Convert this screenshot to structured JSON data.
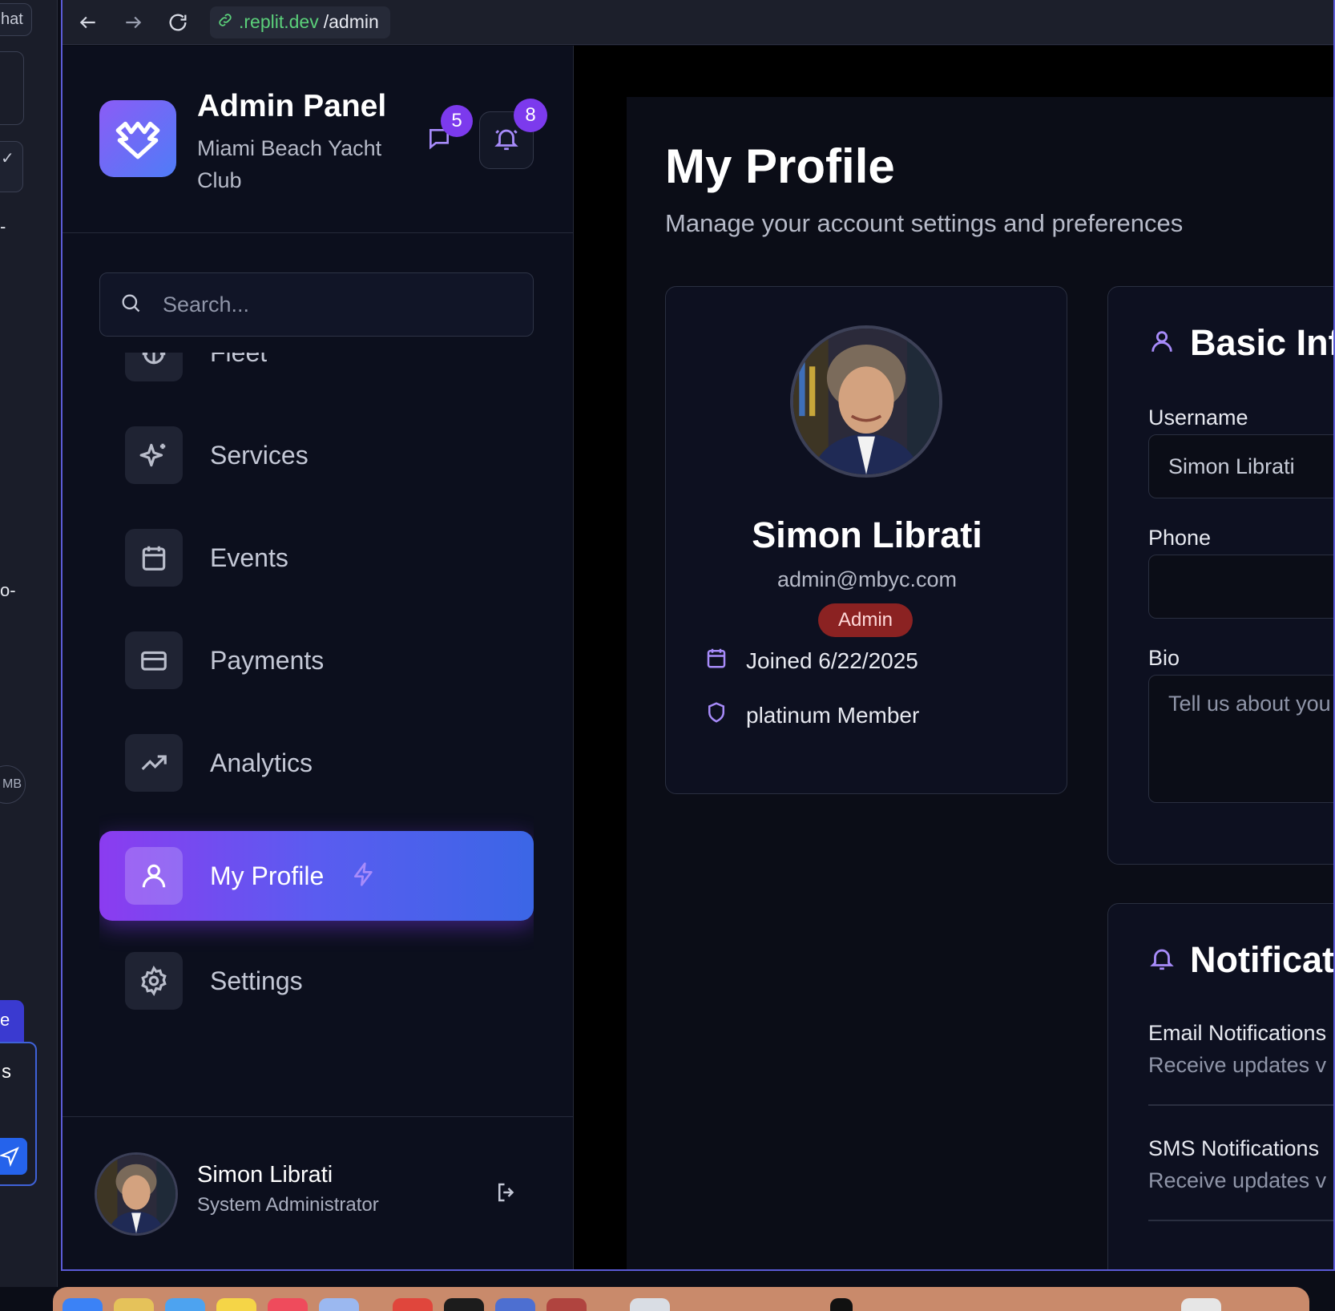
{
  "left_strip": {
    "chip_top": "hat",
    "chip_mid": "✓",
    "text_dash": "-",
    "text_o": "o-",
    "avatar_initials": "MB",
    "blue_tab": "e",
    "panel_letter": "s"
  },
  "browser": {
    "url_host": ".replit.dev",
    "url_path": "/admin"
  },
  "sidebar": {
    "title": "Admin Panel",
    "subtitle": "Miami Beach Yacht Club",
    "message_badge": "5",
    "notification_badge": "8",
    "search_placeholder": "Search...",
    "items": [
      {
        "label": "Fleet",
        "icon": "anchor-icon"
      },
      {
        "label": "Services",
        "icon": "sparkles-icon"
      },
      {
        "label": "Events",
        "icon": "calendar-icon"
      },
      {
        "label": "Payments",
        "icon": "credit-card-icon"
      },
      {
        "label": "Analytics",
        "icon": "trending-up-icon"
      },
      {
        "label": "My Profile",
        "icon": "user-icon",
        "active": true
      },
      {
        "label": "Settings",
        "icon": "gear-icon"
      }
    ],
    "footer": {
      "name": "Simon Librati",
      "role": "System Administrator"
    }
  },
  "main": {
    "title": "My Profile",
    "subtitle": "Manage your account settings and preferences",
    "profile_card": {
      "name": "Simon Librati",
      "email": "admin@mbyc.com",
      "role_badge": "Admin",
      "joined": "Joined 6/22/2025",
      "membership": "platinum Member"
    },
    "basic_info": {
      "heading": "Basic Info",
      "username_label": "Username",
      "username_value": "Simon Librati",
      "phone_label": "Phone",
      "phone_value": "",
      "bio_label": "Bio",
      "bio_placeholder": "Tell us about you"
    },
    "notifications": {
      "heading": "Notifications",
      "email_title": "Email Notifications",
      "email_desc": "Receive updates v",
      "sms_title": "SMS Notifications",
      "sms_desc": "Receive updates v"
    }
  },
  "colors": {
    "accent_purple": "#8b5cf6",
    "accent_blue": "#3b66e6",
    "badge_purple": "#7c3aed",
    "admin_badge": "#8b2222",
    "url_green": "#5bd07a"
  }
}
